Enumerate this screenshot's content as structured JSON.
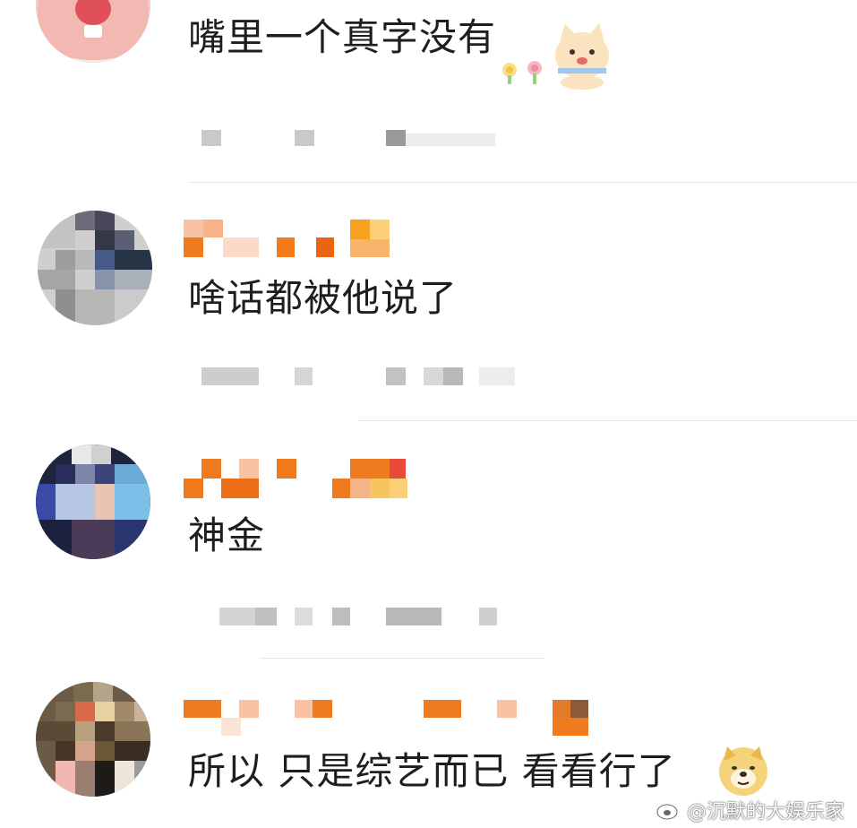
{
  "comments": [
    {
      "text": "嘴里一个真字没有",
      "avatar": "pig-avatar",
      "sticker": "cat-sticker"
    },
    {
      "text": "啥话都被他说了",
      "avatar": "blurred-avatar"
    },
    {
      "text": "神金",
      "avatar": "anime-girl-avatar"
    },
    {
      "text": "所以 只是综艺而已 看看行了",
      "avatar": "blurred-avatar",
      "sticker": "doge-emoji"
    }
  ],
  "watermark": {
    "text": "@沉默的大娱乐家",
    "icon": "weibo-logo-icon"
  },
  "colors": {
    "username_orange": "#f07a1e",
    "username_light": "#f8c8a8",
    "meta_gray": "#c8c8c8",
    "divider": "#e6e6e6"
  }
}
